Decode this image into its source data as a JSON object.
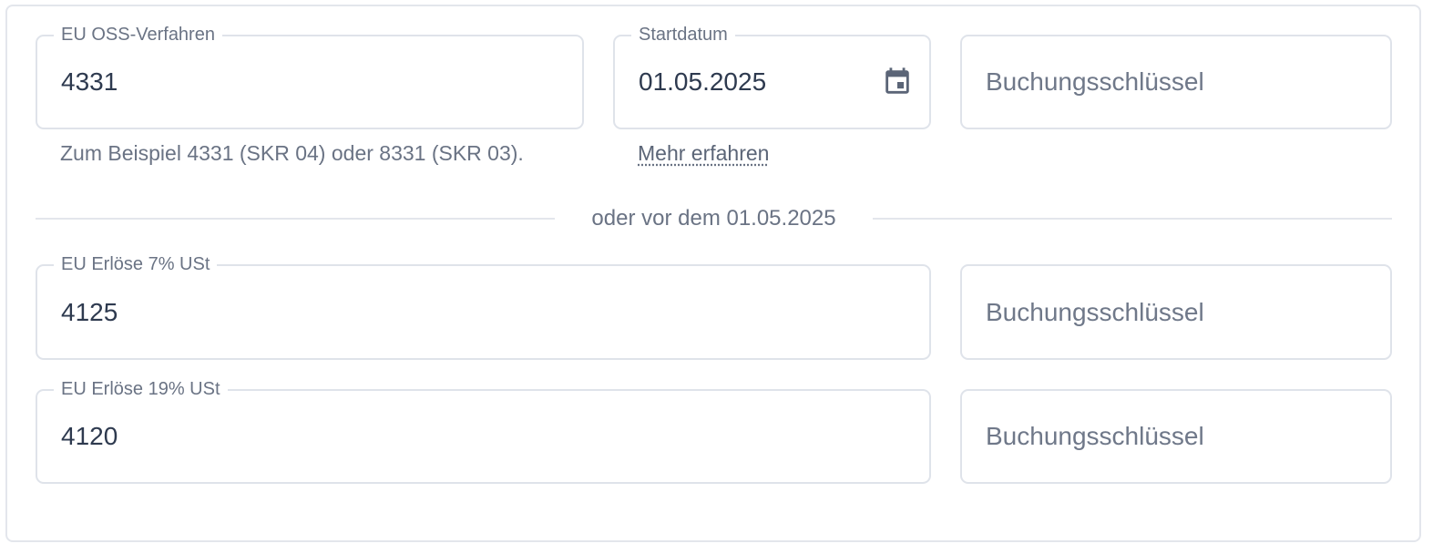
{
  "oss": {
    "label": "EU OSS-Verfahren",
    "value": "4331",
    "helper": "Zum Beispiel 4331 (SKR 04) oder 8331 (SKR 03)."
  },
  "startdate": {
    "label": "Startdatum",
    "value": "01.05.2025",
    "link": "Mehr erfahren",
    "icon": "calendar-icon"
  },
  "booking_key_1": {
    "placeholder": "Buchungsschlüssel"
  },
  "divider": {
    "text": "oder vor dem 01.05.2025"
  },
  "revenue_7": {
    "label": "EU Erlöse 7% USt",
    "value": "4125"
  },
  "booking_key_2": {
    "placeholder": "Buchungsschlüssel"
  },
  "revenue_19": {
    "label": "EU Erlöse 19% USt",
    "value": "4120"
  },
  "booking_key_3": {
    "placeholder": "Buchungsschlüssel"
  },
  "colors": {
    "border": "#dfe3ea",
    "text": "#2e3a4f",
    "muted": "#6a7384",
    "icon": "#5b6577"
  }
}
